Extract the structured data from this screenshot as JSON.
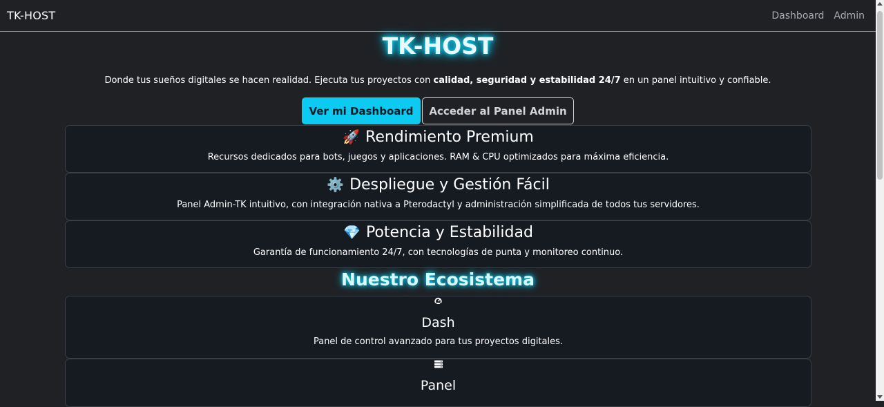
{
  "navbar": {
    "brand": "TK-HOST",
    "links": [
      "Dashboard",
      "Admin"
    ]
  },
  "hero": {
    "title": "TK-HOST",
    "subtitle_pre": "Donde tus sueños digitales se hacen realidad. Ejecuta tus proyectos con ",
    "subtitle_bold": "calidad, seguridad y estabilidad 24/7",
    "subtitle_post": " en un panel intuitivo y confiable.",
    "primary_button": "Ver mi Dashboard",
    "secondary_button": "Acceder al Panel Admin"
  },
  "features": [
    {
      "icon": "🚀",
      "icon_name": "rocket-icon",
      "title": "Rendimiento Premium",
      "description": "Recursos dedicados para bots, juegos y aplicaciones. RAM & CPU optimizados para máxima eficiencia."
    },
    {
      "icon": "⚙️",
      "icon_name": "gear-icon",
      "title": "Despliegue y Gestión Fácil",
      "description": "Panel Admin-TK intuitivo, con integración nativa a Pterodactyl y administración simplificada de todos tus servidores."
    },
    {
      "icon": "💎",
      "icon_name": "gem-icon",
      "title": "Potencia y Estabilidad",
      "description": "Garantía de funcionamiento 24/7, con tecnologías de punta y monitoreo continuo."
    }
  ],
  "ecosystem": {
    "title": "Nuestro Ecosistema",
    "items": [
      {
        "icon_name": "gauge-icon",
        "title": "Dash",
        "description": "Panel de control avanzado para tus proyectos digitales."
      },
      {
        "icon_name": "server-icon",
        "title": "Panel",
        "description": ""
      }
    ]
  },
  "colors": {
    "accent": "#0dcaf0",
    "background": "#1f2125",
    "card": "#161a21"
  }
}
